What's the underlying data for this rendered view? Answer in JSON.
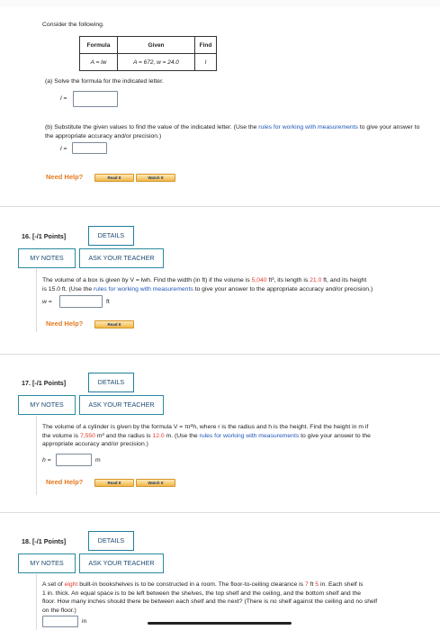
{
  "top": {
    "consider": "Consider the following.",
    "table": {
      "headers": [
        "Formula",
        "Given",
        "Find"
      ],
      "row": [
        "A = lw",
        "A = 672, w = 24.0",
        "l"
      ]
    },
    "part_a": "(a) Solve the formula for the indicated letter.",
    "part_a_var": "l =",
    "part_b_pre": "(b) Substitute the given values to find the value of the indicated letter. (Use the ",
    "part_b_link": "rules for working with measurements",
    "part_b_post": " to give your answer to the appropriate accuracy and/or precision.)",
    "part_b_var": "l =",
    "need_help": "Need Help?",
    "read_it": "Read It",
    "watch_it": "Watch It"
  },
  "q16": {
    "head": "16.  [-/1 Points]",
    "details": "DETAILS",
    "my_notes": "MY NOTES",
    "ask": "ASK YOUR TEACHER",
    "t1": "The volume of a box is given by V = lwh. Find the width (in ft) if the volume is ",
    "v_volume": "5,040",
    "t2": " ft³, its length is ",
    "v_length": "21.0",
    "t3": " ft, and its height",
    "t4": "is 15.0 ft. (Use the ",
    "link": "rules for working with measurements",
    "t5": " to give your answer to the appropriate accuracy and/or precision.)",
    "var": "w =",
    "unit": "ft",
    "need_help": "Need Help?",
    "read_it": "Read It"
  },
  "q17": {
    "head": "17.  [-/1 Points]",
    "details": "DETAILS",
    "my_notes": "MY NOTES",
    "ask": "ASK YOUR TEACHER",
    "t1": "The volume of a cylinder is given by the formula V = πr²h, where r is the radius and h is the height. Find the height in m if",
    "t2": "the volume is ",
    "v_volume": "7,550",
    "t3": " m³ and the radius is ",
    "v_radius": "12.0",
    "t4": " m. (Use the ",
    "link": "rules for working with measurements",
    "t5": " to give your answer to the",
    "t6": "appropriate accuracy and/or precision.)",
    "var": "h =",
    "unit": "m",
    "need_help": "Need Help?",
    "read_it": "Read It",
    "watch_it": "Watch It"
  },
  "q18": {
    "head": "18.  [-/1 Points]",
    "details": "DETAILS",
    "my_notes": "MY NOTES",
    "ask": "ASK YOUR TEACHER",
    "t1a": "A set of ",
    "v_eight": "eight",
    "t1b": " built-in bookshelves is to be constructed in a room. The floor-to-ceiling clearance is ",
    "v_ft": "7",
    "t1c": " ft ",
    "v_in": "5",
    "t1d": " in. Each shelf is",
    "t2": "1 in. thick. An equal space is to be left between the shelves, the top shelf and the ceiling, and the bottom shelf and the",
    "t3": "floor. How many inches should there be between each shelf and the next? (There is no shelf against the ceiling and no shelf",
    "t4": "on the floor.)",
    "unit": "in"
  }
}
